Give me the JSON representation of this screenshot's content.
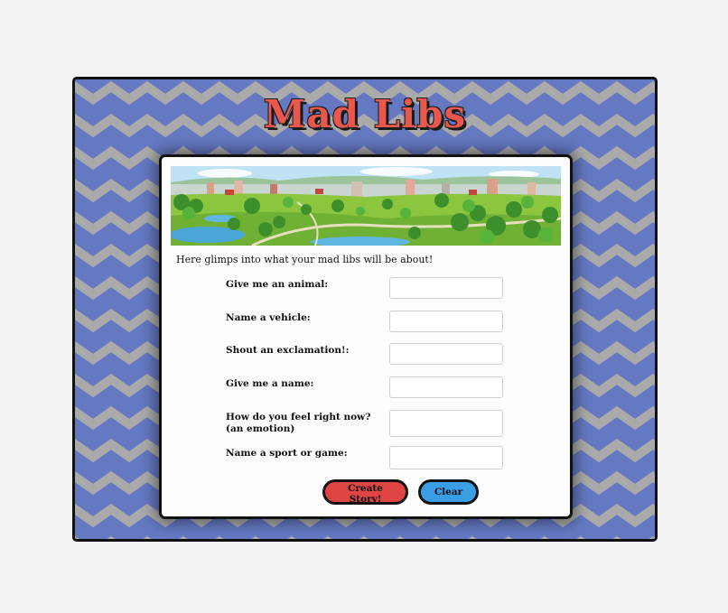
{
  "app": {
    "title": "Mad Libs"
  },
  "banner": {
    "alt": "cartoon park landscape"
  },
  "intro_text": "Here glimps into what your mad libs will be about!",
  "form": {
    "fields": [
      {
        "label": "Give me an animal:",
        "value": "",
        "placeholder": ""
      },
      {
        "label": "Name a vehicle:",
        "value": "",
        "placeholder": ""
      },
      {
        "label": "Shout an exclamation!:",
        "value": "",
        "placeholder": ""
      },
      {
        "label": "Give me a name:",
        "value": "",
        "placeholder": ""
      },
      {
        "label": "How do you feel right now? (an emotion)",
        "value": "",
        "placeholder": ""
      },
      {
        "label": "Name a sport or game:",
        "value": "",
        "placeholder": ""
      }
    ],
    "create_label": "Create Story!",
    "clear_label": "Clear"
  },
  "colors": {
    "background_blue": "#6579c2",
    "zigzag_gray": "#aaaaaa",
    "title_red": "#e8584d",
    "create_button": "#e04545",
    "clear_button": "#3a9ee4"
  }
}
